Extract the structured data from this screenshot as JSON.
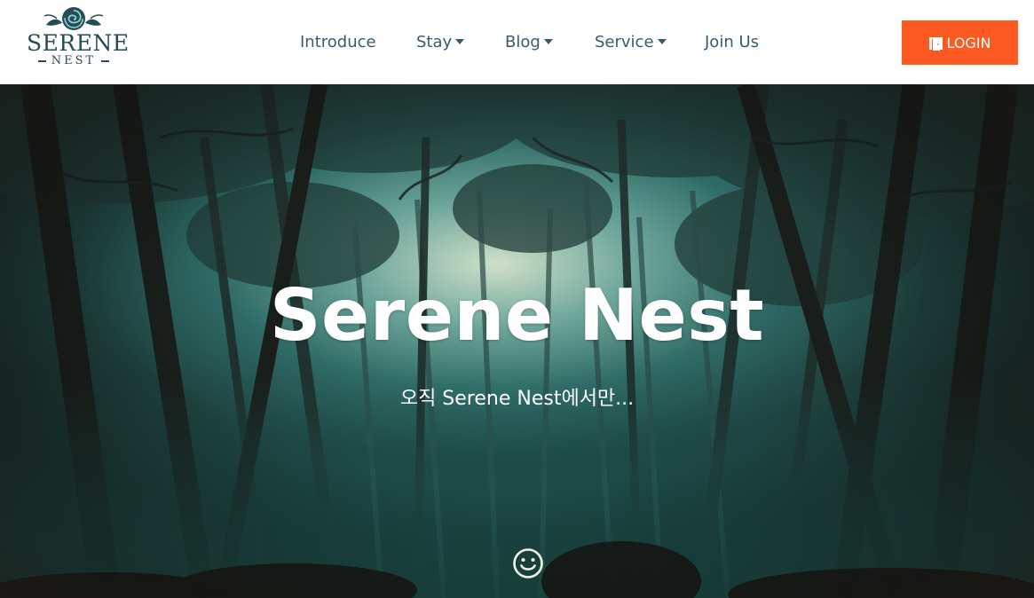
{
  "brand": {
    "name_top": "SERENE",
    "name_bottom": "NEST"
  },
  "nav": {
    "items": [
      {
        "label": "Introduce",
        "dropdown": false
      },
      {
        "label": "Stay",
        "dropdown": true
      },
      {
        "label": "Blog",
        "dropdown": true
      },
      {
        "label": "Service",
        "dropdown": true
      },
      {
        "label": "Join Us",
        "dropdown": false
      }
    ],
    "login_label": "LOGIN",
    "login_color": "#fd5a22"
  },
  "hero": {
    "title": "Serene Nest",
    "subtitle": "오직 Serene Nest에서만...",
    "scroll_icon": "smiley-icon"
  }
}
